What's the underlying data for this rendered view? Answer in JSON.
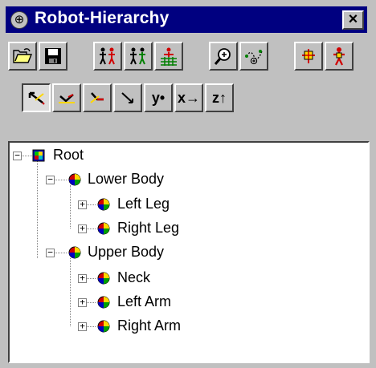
{
  "window": {
    "title": "Robot-Hierarchy",
    "close_label": "×"
  },
  "toolbar1": {
    "buttons": [
      {
        "name": "open-folder-button",
        "icon": "open-folder-icon"
      },
      {
        "name": "save-button",
        "icon": "floppy-disk-icon"
      },
      {
        "name": "figures-red-button",
        "icon": "figures-red-icon"
      },
      {
        "name": "figures-green-button",
        "icon": "figures-green-icon"
      },
      {
        "name": "figure-grid-button",
        "icon": "figure-grid-icon"
      },
      {
        "name": "zoom-button",
        "icon": "magnifier-icon"
      },
      {
        "name": "path-nodes-button",
        "icon": "path-nodes-icon"
      },
      {
        "name": "joint-yellow-button",
        "icon": "joint-yellow-icon"
      },
      {
        "name": "figure-joint-button",
        "icon": "figure-joint-icon"
      }
    ]
  },
  "toolbar2": {
    "buttons": [
      {
        "name": "axis-tool-1-button",
        "icon": "axis-arrow-icon",
        "pressed": true
      },
      {
        "name": "axis-tool-2-button",
        "icon": "axis-check-icon"
      },
      {
        "name": "axis-tool-3-button",
        "icon": "axis-down-icon"
      },
      {
        "name": "axis-tool-4-button",
        "icon": "diagonal-arrow-icon"
      },
      {
        "name": "y-axis-button",
        "label": "y•"
      },
      {
        "name": "x-axis-button",
        "label": "x→"
      },
      {
        "name": "z-axis-button",
        "label": "z↑"
      }
    ]
  },
  "tree": {
    "nodes": [
      {
        "label": "Root",
        "level": 0,
        "expander": "−",
        "icon": "root-cube-icon"
      },
      {
        "label": "Lower Body",
        "level": 1,
        "expander": "−",
        "icon": "sphere-icon"
      },
      {
        "label": "Left Leg",
        "level": 2,
        "expander": "+",
        "icon": "sphere-icon"
      },
      {
        "label": "Right Leg",
        "level": 2,
        "expander": "+",
        "icon": "sphere-icon"
      },
      {
        "label": "Upper Body",
        "level": 1,
        "expander": "−",
        "icon": "sphere-icon"
      },
      {
        "label": "Neck",
        "level": 2,
        "expander": "+",
        "icon": "sphere-icon"
      },
      {
        "label": "Left Arm",
        "level": 2,
        "expander": "+",
        "icon": "sphere-icon"
      },
      {
        "label": "Right Arm",
        "level": 2,
        "expander": "+",
        "icon": "sphere-icon"
      }
    ]
  }
}
